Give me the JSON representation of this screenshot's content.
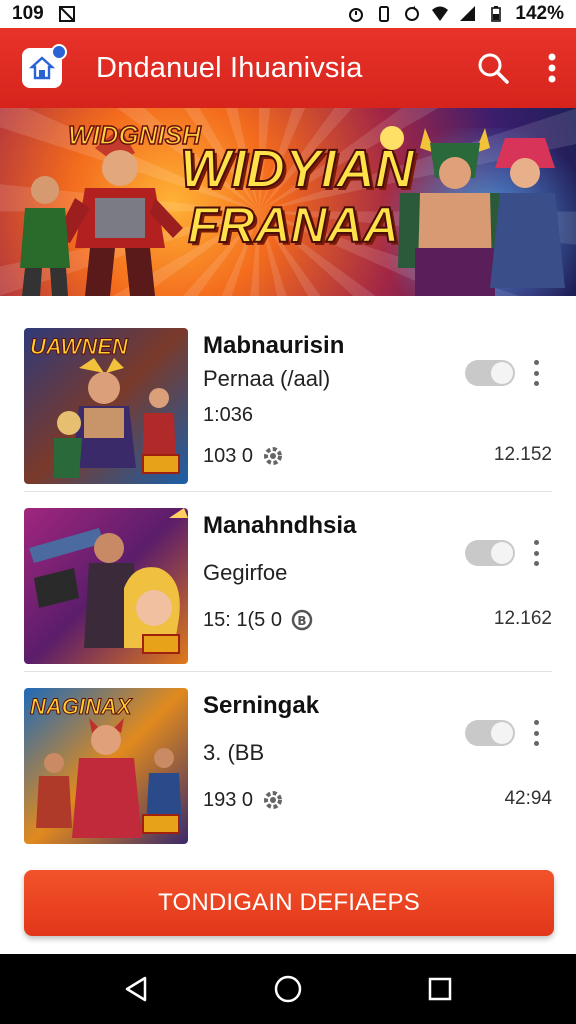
{
  "status_bar": {
    "time": "109",
    "battery_text": "142%"
  },
  "app_bar": {
    "title": "Dndanuel Ihuanivsia"
  },
  "banner": {
    "small_title": "WIDGNISH",
    "line1": "WIDYIAN",
    "line2": "FRANAA !"
  },
  "items": [
    {
      "title": "Mabnaurisin",
      "subtitle": "Pernaa (/aal)",
      "meta": "1:036",
      "stats": "103 0",
      "size": "12.152",
      "thumb_title": "UAWNEN",
      "thumb_colors": [
        "#3b2a6b",
        "#e8a326",
        "#1b5fa8"
      ]
    },
    {
      "title": "Manahndhsia",
      "subtitle": "Gegirfoe",
      "meta": "",
      "stats": "15: 1(5 0",
      "size": "12.162",
      "thumb_title": "",
      "thumb_colors": [
        "#8c1f7a",
        "#f0a120",
        "#2b1d4d"
      ]
    },
    {
      "title": "Serningak",
      "subtitle": "3. (BB",
      "meta": "",
      "stats": "193 0",
      "size": "42:94",
      "thumb_title": "NAGINAX",
      "thumb_colors": [
        "#2a5fb0",
        "#f08a1e",
        "#6a1a3a"
      ]
    }
  ],
  "cta": {
    "label": "TONDIGAIN DEFIAEPS"
  },
  "colors": {
    "accent": "#e02c22",
    "nav": "#000000"
  }
}
